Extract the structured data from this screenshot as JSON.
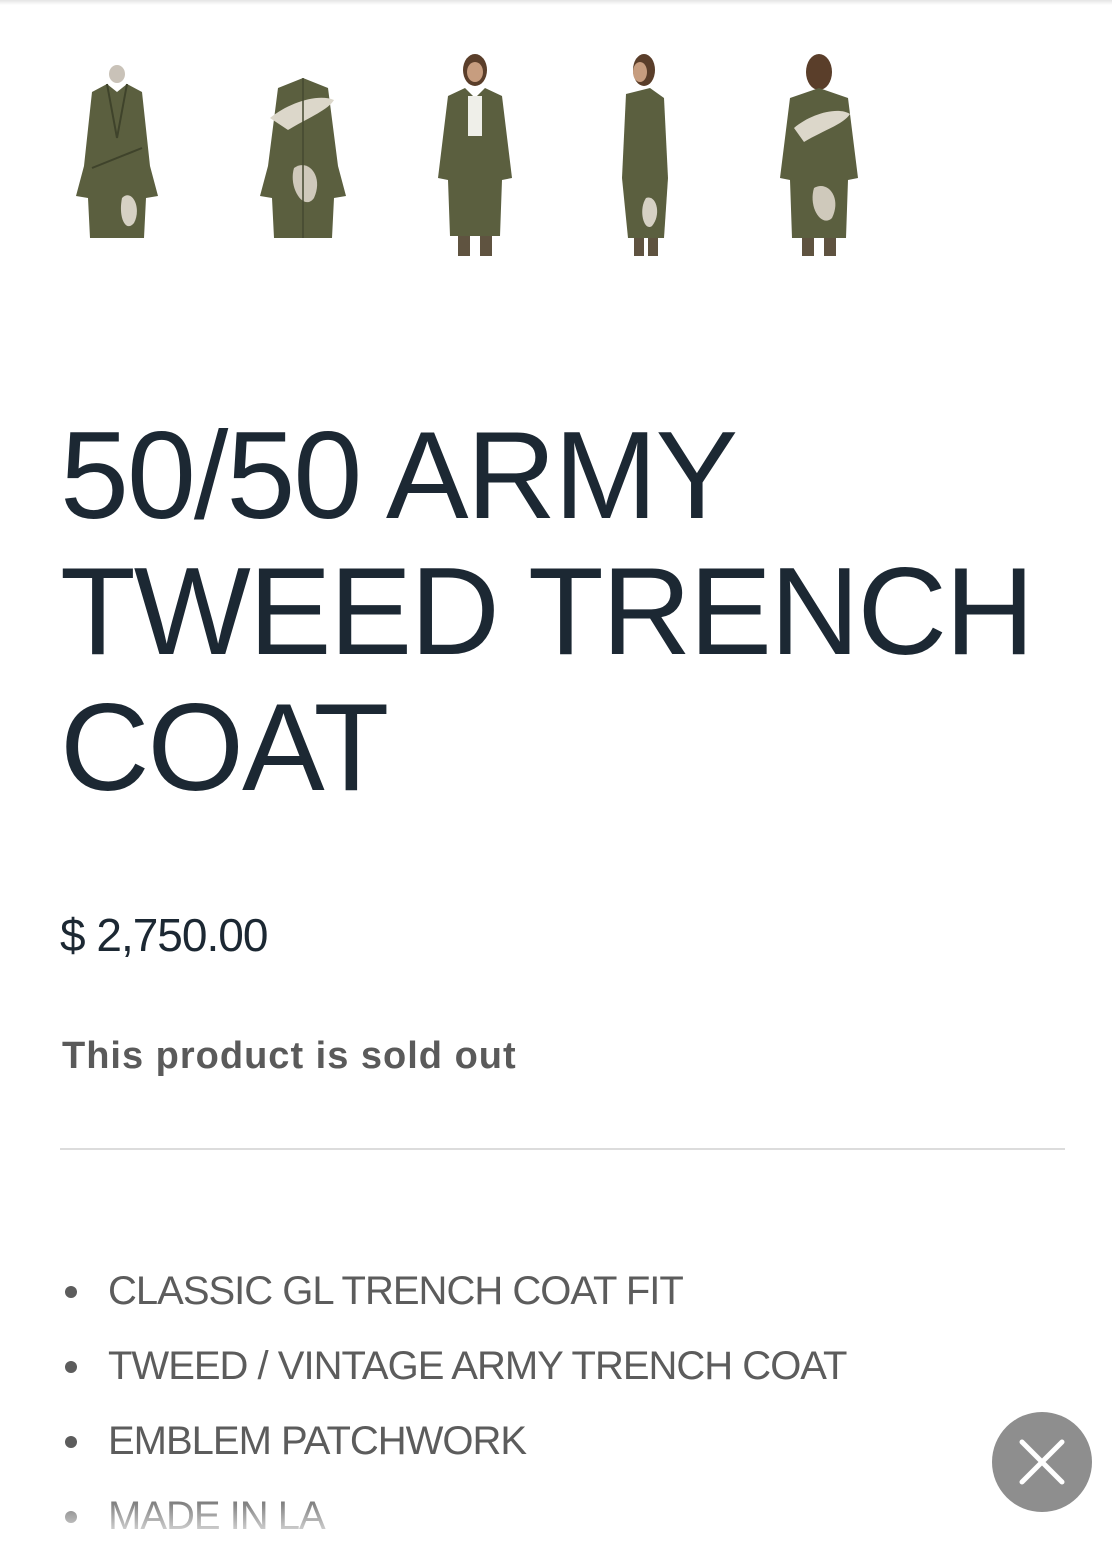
{
  "gallery": {
    "thumbnails": [
      {
        "icon": "coat-front-mannequin-image"
      },
      {
        "icon": "coat-back-mannequin-image"
      },
      {
        "icon": "model-front-image"
      },
      {
        "icon": "model-side-image"
      },
      {
        "icon": "model-back-image"
      }
    ]
  },
  "product": {
    "title": "50/50 ARMY TWEED TRENCH COAT",
    "price": "$ 2,750.00",
    "availability": "This product is sold out",
    "features": [
      "CLASSIC GL TRENCH COAT FIT",
      "TWEED / VINTAGE ARMY TRENCH COAT",
      "EMBLEM PATCHWORK",
      "MADE IN LA"
    ]
  },
  "overlay": {
    "close_icon": "close-icon"
  },
  "colors": {
    "title": "#1c2833",
    "muted_text": "#5a5a5a",
    "coat_olive": "#5b5f3f",
    "close_button": "#8e8e8e"
  }
}
